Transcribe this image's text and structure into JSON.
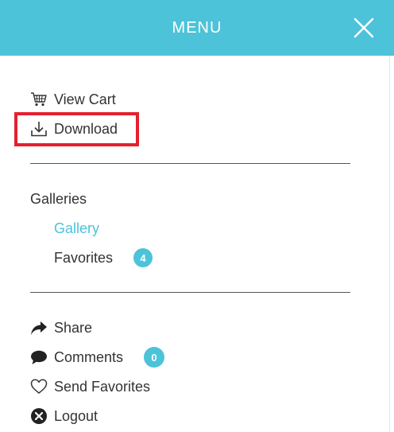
{
  "header": {
    "title": "MENU",
    "close_icon": "close-x-icon",
    "background": "#4cc3d9"
  },
  "actions": [
    {
      "label": "View Cart",
      "icon": "cart-icon"
    },
    {
      "label": "Download",
      "icon": "download-icon",
      "highlighted": true
    }
  ],
  "galleries": {
    "heading": "Galleries",
    "items": [
      {
        "label": "Gallery",
        "active": true
      },
      {
        "label": "Favorites",
        "badge": "4"
      }
    ]
  },
  "social": [
    {
      "label": "Share",
      "icon": "share-arrow-icon"
    },
    {
      "label": "Comments",
      "icon": "speech-bubble-icon",
      "badge": "0"
    },
    {
      "label": "Send Favorites",
      "icon": "heart-icon"
    },
    {
      "label": "Logout",
      "icon": "x-circle-icon"
    }
  ],
  "colors": {
    "accent": "#4cc3d9",
    "highlight": "#e5202e",
    "text": "#333333"
  }
}
